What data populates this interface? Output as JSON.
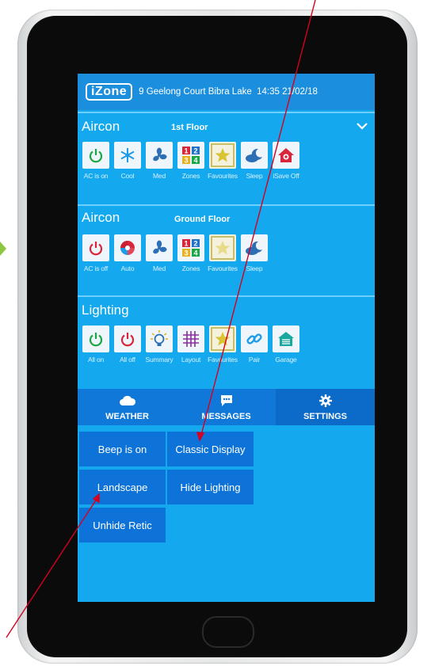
{
  "header": {
    "logo": "iZone",
    "address": "9 Geelong Court Bibra Lake",
    "time": "14:35",
    "date": "21/02/18"
  },
  "aircon1": {
    "title": "Aircon",
    "zone": "1st Floor",
    "tiles": [
      {
        "label": "AC is on",
        "icon": "power-icon"
      },
      {
        "label": "Cool",
        "icon": "snowflake-icon"
      },
      {
        "label": "Med",
        "icon": "fan-icon"
      },
      {
        "label": "Zones",
        "icon": "zones-grid-icon"
      },
      {
        "label": "Favourites",
        "icon": "star-icon"
      },
      {
        "label": "Sleep",
        "icon": "sleep-icon"
      },
      {
        "label": "iSave Off",
        "icon": "isave-icon"
      }
    ]
  },
  "aircon2": {
    "title": "Aircon",
    "zone": "Ground Floor",
    "tiles": [
      {
        "label": "AC is off",
        "icon": "power-icon"
      },
      {
        "label": "Auto",
        "icon": "auto-mode-icon"
      },
      {
        "label": "Med",
        "icon": "fan-icon"
      },
      {
        "label": "Zones",
        "icon": "zones-grid-icon"
      },
      {
        "label": "Favourites",
        "icon": "star-icon"
      },
      {
        "label": "Sleep",
        "icon": "sleep-icon"
      }
    ]
  },
  "lighting": {
    "title": "Lighting",
    "tiles": [
      {
        "label": "All on",
        "icon": "power-icon"
      },
      {
        "label": "All off",
        "icon": "power-icon"
      },
      {
        "label": "Summary",
        "icon": "bulb-icon"
      },
      {
        "label": "Layout",
        "icon": "layout-grid-icon"
      },
      {
        "label": "Favourites",
        "icon": "star-icon"
      },
      {
        "label": "Pair",
        "icon": "link-icon"
      },
      {
        "label": "Garage",
        "icon": "garage-icon"
      }
    ]
  },
  "nav": {
    "weather": "WEATHER",
    "messages": "MESSAGES",
    "settings": "SETTINGS"
  },
  "settings": {
    "beep": "Beep is on",
    "display": "Classic Display",
    "orientation": "Landscape",
    "lighting": "Hide Lighting",
    "retic": "Unhide Retic"
  },
  "colors": {
    "screen": "#14a9ee",
    "header": "#1b8fde",
    "button": "#0e73d8",
    "on": "#19a845",
    "off": "#d8253b",
    "annotation": "#d4001f"
  }
}
